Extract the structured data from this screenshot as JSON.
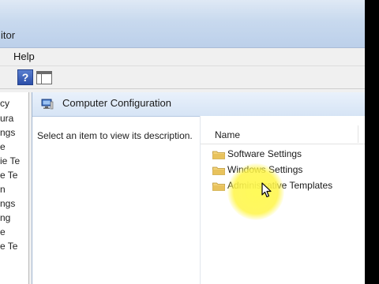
{
  "window": {
    "title_fragment": "itor"
  },
  "menubar": {
    "items": [
      {
        "label": "Help"
      }
    ]
  },
  "toolbar": {
    "buttons": [
      {
        "icon": "help-icon",
        "glyph": "?"
      },
      {
        "icon": "view-columns-icon"
      }
    ]
  },
  "tree": {
    "visible_fragments": [
      "cy",
      "ura",
      "ngs",
      "e",
      "ie Te",
      "e Te",
      "n",
      "ngs",
      "ng",
      "e",
      "e Te"
    ]
  },
  "detail": {
    "header_title": "Computer Configuration",
    "description": "Select an item to view its description.",
    "list_column": "Name",
    "items": [
      {
        "label": "Software Settings"
      },
      {
        "label": "Windows Settings"
      },
      {
        "label": "Administrative Templates"
      }
    ]
  },
  "colors": {
    "accent_highlight": "#fff34a",
    "titlebar": "#c8d9ee",
    "folder": "#e8c25c"
  }
}
